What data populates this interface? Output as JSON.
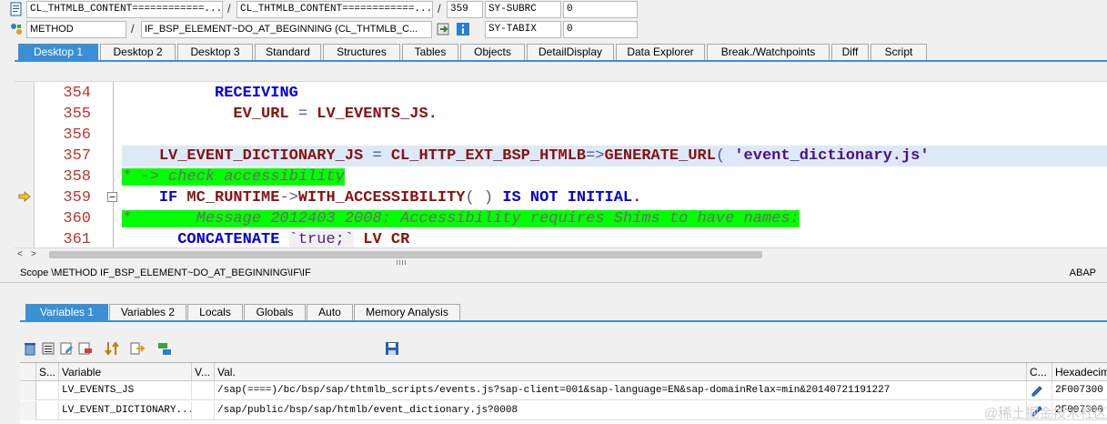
{
  "info": {
    "row1": {
      "field1": "CL_THTMLB_CONTENT============...",
      "sep1": "/",
      "field2": "CL_THTMLB_CONTENT============...",
      "sep2": "/",
      "line": "359",
      "sysfield": "SY-SUBRC",
      "sysval": "0"
    },
    "row2": {
      "type": "METHOD",
      "sep1": "/",
      "method": "IF_BSP_ELEMENT~DO_AT_BEGINNING (CL_THTMLB_C...",
      "sysfield": "SY-TABIX",
      "sysval": "0"
    }
  },
  "desktop_tabs": [
    "Desktop 1",
    "Desktop 2",
    "Desktop 3",
    "Standard",
    "Structures",
    "Tables",
    "Objects",
    "DetailDisplay",
    "Data Explorer",
    "Break./Watchpoints",
    "Diff",
    "Script"
  ],
  "code": {
    "lines": [
      {
        "num": "354",
        "parts": [
          [
            "",
            "          "
          ],
          [
            "kw",
            "RECEIVING"
          ]
        ]
      },
      {
        "num": "355",
        "parts": [
          [
            "",
            "            "
          ],
          [
            "id",
            "EV_URL"
          ],
          [
            "op",
            " = "
          ],
          [
            "id",
            "LV_EVENTS_JS"
          ],
          [
            "id",
            "."
          ]
        ]
      },
      {
        "num": "356",
        "parts": []
      },
      {
        "num": "357",
        "parts": [
          [
            "",
            "    "
          ],
          [
            "id",
            "LV_EVENT_DICTIONARY_JS"
          ],
          [
            "op",
            " = "
          ],
          [
            "id",
            "CL_HTTP_EXT_BSP_HTMLB"
          ],
          [
            "op",
            "=>"
          ],
          [
            "id",
            "GENERATE_URL"
          ],
          [
            "op",
            "( "
          ],
          [
            "str",
            "'event_dictionary.js'"
          ]
        ]
      },
      {
        "num": "358",
        "parts": [
          [
            "cmt",
            "* -> check accessibility"
          ]
        ]
      },
      {
        "num": "359",
        "parts": [
          [
            "",
            "    "
          ],
          [
            "kw",
            "IF"
          ],
          [
            "",
            " "
          ],
          [
            "id",
            "MC_RUNTIME"
          ],
          [
            "op",
            "->"
          ],
          [
            "id",
            "WITH_ACCESSIBILITY"
          ],
          [
            "op",
            "( ) "
          ],
          [
            "kw",
            "IS NOT INITIAL"
          ],
          [
            "id",
            "."
          ]
        ]
      },
      {
        "num": "360",
        "parts": [
          [
            "cmt",
            "*       Message 2012403 2008: Accessibility requires Shims to have names:"
          ]
        ]
      },
      {
        "num": "361",
        "parts": [
          [
            "",
            "      "
          ],
          [
            "kw",
            "CONCATENATE"
          ],
          [
            "",
            " "
          ],
          [
            "strgrave",
            "`true;`"
          ],
          [
            "",
            " "
          ],
          [
            "id",
            "LV CR"
          ]
        ]
      }
    ]
  },
  "scope": {
    "text": "Scope \\METHOD IF_BSP_ELEMENT~DO_AT_BEGINNING\\IF\\IF",
    "lang": "ABAP"
  },
  "lower_tabs": [
    "Variables 1",
    "Variables 2",
    "Locals",
    "Globals",
    "Auto",
    "Memory Analysis"
  ],
  "table": {
    "headers": [
      "S...",
      "Variable",
      "V...",
      "Val.",
      "C...",
      "Hexadecim"
    ],
    "rows": [
      {
        "variable": "LV_EVENTS_JS",
        "value": "/sap(====)/bc/bsp/sap/thtmlb_scripts/events.js?sap-client=001&sap-language=EN&sap-domainRelax=min&20140721191227",
        "hex": "2F007300"
      },
      {
        "variable": "LV_EVENT_DICTIONARY...",
        "value": "/sap/public/bsp/sap/htmlb/event_dictionary.js?0008",
        "hex": "2F007300"
      }
    ]
  },
  "watermark": "@稀土掘金技术社区",
  "colors": {
    "active_tab": "#3b8fd5",
    "comment_bg": "#00ff00",
    "keyword": "#0000d8",
    "identifier": "#8a1111",
    "line_number": "#b8372e"
  }
}
